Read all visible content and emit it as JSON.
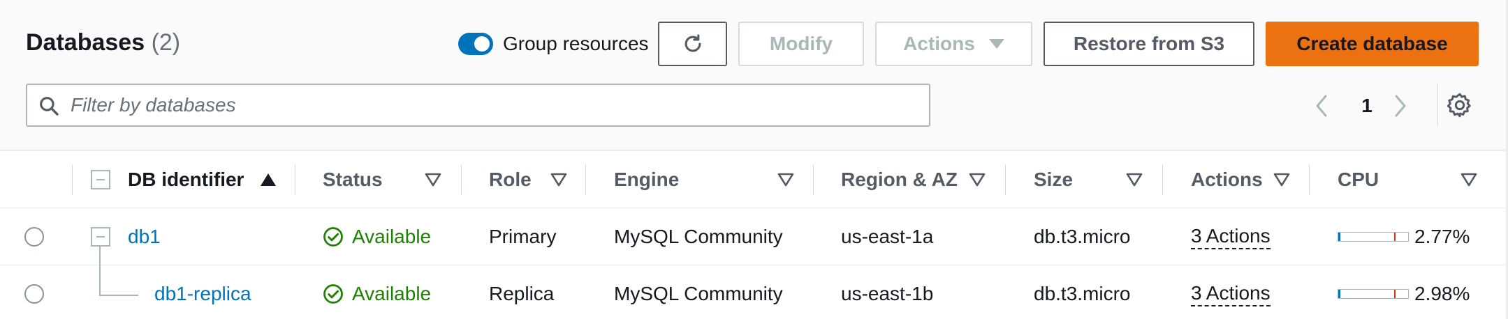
{
  "header": {
    "title": "Databases",
    "count": "(2)",
    "group_resources_label": "Group resources",
    "group_resources_on": true
  },
  "toolbar": {
    "refresh_icon": "refresh-icon",
    "modify_label": "Modify",
    "actions_label": "Actions",
    "restore_label": "Restore from S3",
    "create_label": "Create database"
  },
  "search": {
    "placeholder": "Filter by databases",
    "value": ""
  },
  "pagination": {
    "current_page": "1"
  },
  "colors": {
    "accent": "#0073bb",
    "primary_button": "#ec7211",
    "available": "#1d8102",
    "cpu_marker": "#d13212"
  },
  "table": {
    "columns": [
      {
        "label": "DB identifier",
        "sort": "ascending"
      },
      {
        "label": "Status"
      },
      {
        "label": "Role"
      },
      {
        "label": "Engine"
      },
      {
        "label": "Region & AZ"
      },
      {
        "label": "Size"
      },
      {
        "label": "Actions"
      },
      {
        "label": "CPU"
      }
    ],
    "rows": [
      {
        "identifier": "db1",
        "status": "Available",
        "role": "Primary",
        "engine": "MySQL Community",
        "region_az": "us-east-1a",
        "size": "db.t3.micro",
        "actions": "3 Actions",
        "cpu_text": "2.77%",
        "cpu_value": 2.77
      },
      {
        "identifier": "db1-replica",
        "status": "Available",
        "role": "Replica",
        "engine": "MySQL Community",
        "region_az": "us-east-1b",
        "size": "db.t3.micro",
        "actions": "3 Actions",
        "cpu_text": "2.98%",
        "cpu_value": 2.98
      }
    ]
  }
}
